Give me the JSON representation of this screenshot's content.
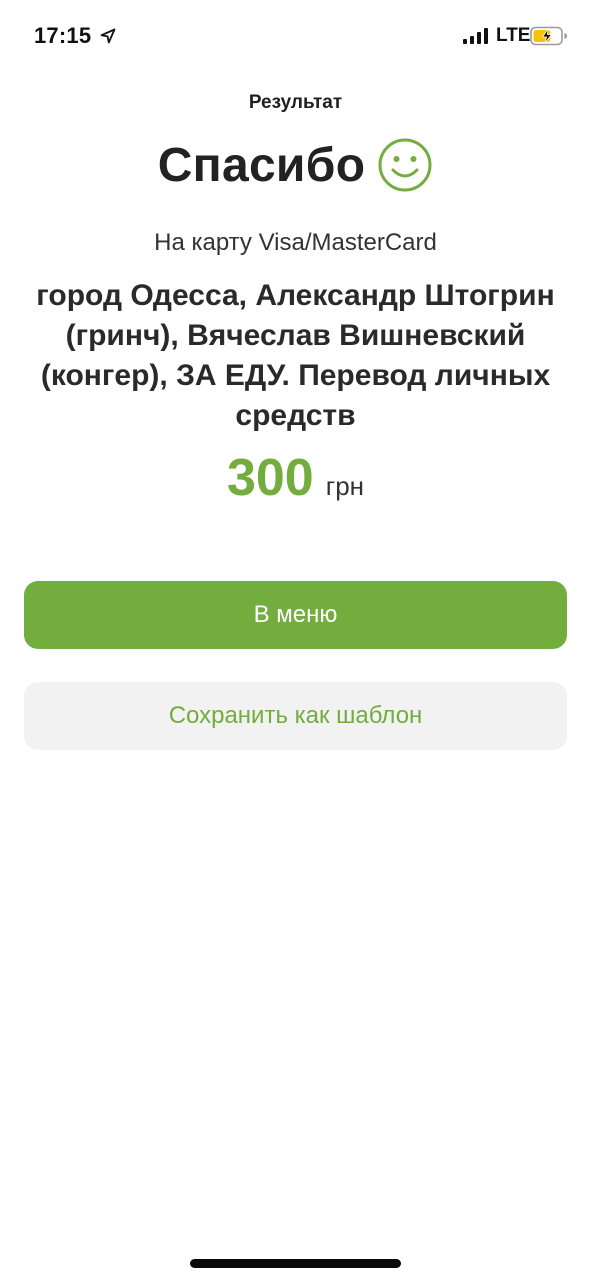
{
  "status_bar": {
    "time": "17:15",
    "network": "LTE",
    "icons": [
      "location-arrow-icon",
      "signal-bars-icon",
      "battery-charging-icon"
    ]
  },
  "header": {
    "title": "Результат"
  },
  "result": {
    "thanks": "Спасибо",
    "thanks_icon": "smile-icon",
    "card_label": "На карту Visa/MasterCard",
    "recipient": "город Одесса, Александр Штогрин (гринч), Вячеслав Вишневский (конгер), ЗА ЕДУ. Перевод личных средств",
    "amount": "300",
    "currency": "грн"
  },
  "actions": {
    "menu_label": "В меню",
    "save_template_label": "Сохранить как шаблон"
  },
  "colors": {
    "accent": "#72ad3e",
    "secondary_button_bg": "#f2f2f2",
    "battery_fill": "#f5c400"
  }
}
